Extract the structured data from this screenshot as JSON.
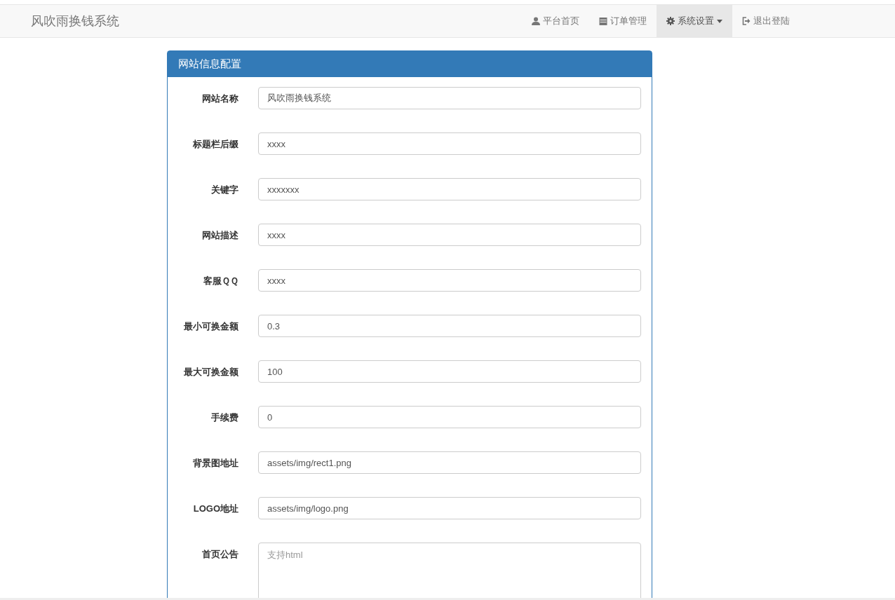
{
  "navbar": {
    "brand": "风吹雨换钱系统",
    "items": [
      {
        "label": "平台首页",
        "selected": false,
        "dropdown": false
      },
      {
        "label": "订单管理",
        "selected": false,
        "dropdown": false
      },
      {
        "label": "系统设置",
        "selected": true,
        "dropdown": true
      },
      {
        "label": "退出登陆",
        "selected": false,
        "dropdown": false
      }
    ]
  },
  "panel": {
    "title": "网站信息配置",
    "fields": [
      {
        "label": "网站名称",
        "kind": "input",
        "value": "风吹雨换钱系统"
      },
      {
        "label": "标题栏后缀",
        "kind": "input",
        "value": "xxxx"
      },
      {
        "label": "关键字",
        "kind": "input",
        "value": "xxxxxxx"
      },
      {
        "label": "网站描述",
        "kind": "input",
        "value": "xxxx"
      },
      {
        "label": "客服ＱＱ",
        "kind": "input",
        "value": "xxxx"
      },
      {
        "label": "最小可换金额",
        "kind": "input",
        "value": "0.3"
      },
      {
        "label": "最大可换金额",
        "kind": "input",
        "value": "100"
      },
      {
        "label": "手续费",
        "kind": "input",
        "value": "0"
      },
      {
        "label": "背景图地址",
        "kind": "input",
        "value": "assets/img/rect1.png"
      },
      {
        "label": "LOGO地址",
        "kind": "input",
        "value": "assets/img/logo.png"
      },
      {
        "label": "首页公告",
        "kind": "textarea",
        "placeholder": "支持html"
      }
    ]
  }
}
